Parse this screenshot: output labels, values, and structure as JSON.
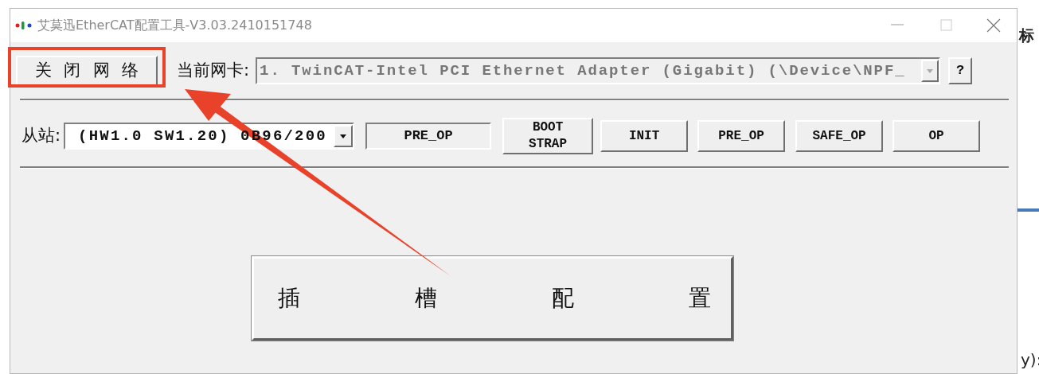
{
  "window": {
    "title": "艾莫迅EtherCAT配置工具-V3.03.2410151748"
  },
  "network_row": {
    "close_button": "关 闭 网 络",
    "adapter_label": "当前网卡:",
    "adapter_value": "1. TwinCAT-Intel PCI Ethernet Adapter (Gigabit) (\\Device\\NPF_",
    "help_button": "?"
  },
  "slave_row": {
    "slave_label": "从站:",
    "slave_value": "(HW1.0 SW1.20) 0B96/200",
    "state_field": "PRE_OP",
    "buttons": [
      {
        "label": "BOOT\nSTRAP"
      },
      {
        "label": "INIT"
      },
      {
        "label": "PRE_OP"
      },
      {
        "label": "SAFE_OP"
      },
      {
        "label": "OP"
      }
    ]
  },
  "slot_button": "插 槽 配 置",
  "background": {
    "heading_fragment": "标",
    "text_fragment": "y):"
  }
}
